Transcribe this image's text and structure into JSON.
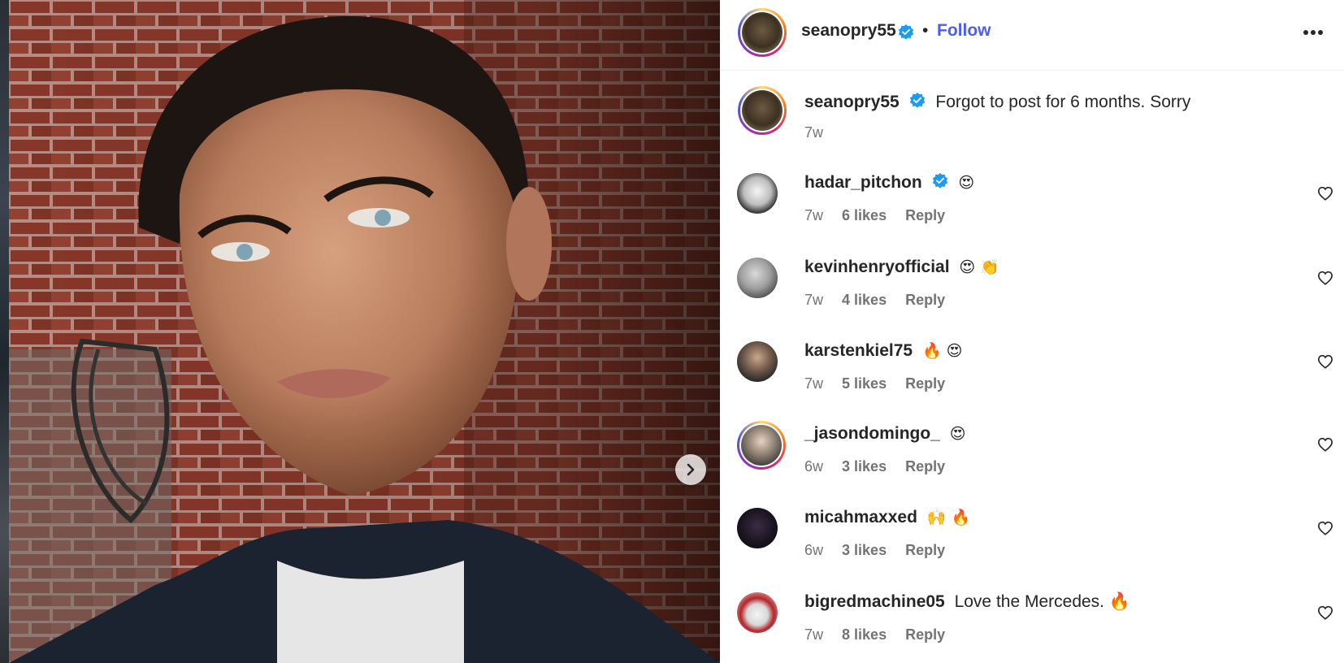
{
  "post": {
    "author": "seanopry55",
    "follow_label": "Follow",
    "separator": "•",
    "caption": "Forgot to post for 6 months. Sorry",
    "caption_time": "7w"
  },
  "comments": [
    {
      "user": "hadar_pitchon",
      "verified": true,
      "text": "😍",
      "time": "7w",
      "likes": "6 likes",
      "reply": "Reply"
    },
    {
      "user": "kevinhenryofficial",
      "verified": false,
      "text": "😍 👏",
      "time": "7w",
      "likes": "4 likes",
      "reply": "Reply"
    },
    {
      "user": "karstenkiel75",
      "verified": false,
      "text": "🔥 😍",
      "time": "7w",
      "likes": "5 likes",
      "reply": "Reply"
    },
    {
      "user": "_jasondomingo_",
      "verified": false,
      "text": "😍",
      "time": "6w",
      "likes": "3 likes",
      "reply": "Reply"
    },
    {
      "user": "micahmaxxed",
      "verified": false,
      "text": "🙌 🔥",
      "time": "6w",
      "likes": "3 likes",
      "reply": "Reply"
    },
    {
      "user": "bigredmachine05",
      "verified": false,
      "text": "Love the Mercedes. 🔥",
      "time": "7w",
      "likes": "8 likes",
      "reply": "Reply"
    }
  ],
  "colors": {
    "follow": "#4a5df9",
    "verified": "#1d9bf0",
    "meta": "#737373"
  },
  "icons": {
    "next": "chevron-right-icon",
    "more": "more-horizontal-icon",
    "like": "heart-outline-icon",
    "verified": "verified-badge-icon"
  }
}
